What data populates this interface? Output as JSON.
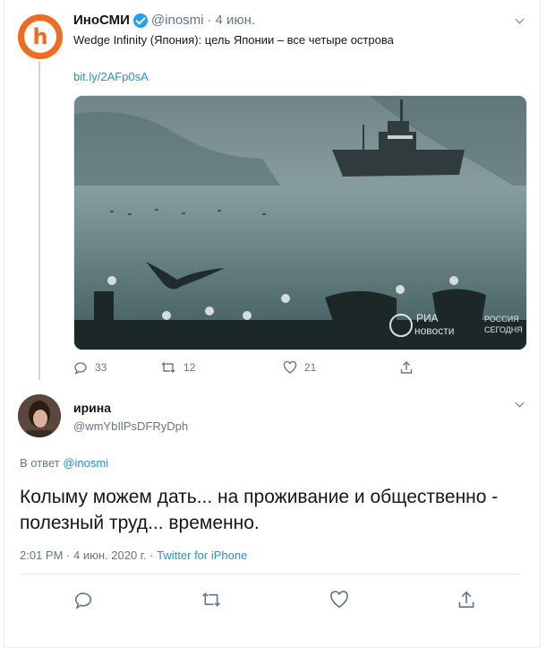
{
  "tweet1": {
    "avatar_letter": "h",
    "name": "ИноСМИ",
    "handle": "@inosmi",
    "separator": "·",
    "date": "4 июн.",
    "text": "Wedge Infinity (Япония): цель Японии – все четыре острова",
    "link": "bit.ly/2AFp0sA",
    "photo_watermark": {
      "line1": "РИА",
      "line2": "новости",
      "line3": "РОССИЯ",
      "line4": "СЕГОДНЯ"
    },
    "actions": {
      "replies": "33",
      "retweets": "12",
      "likes": "21"
    }
  },
  "tweet2": {
    "name": "ирина",
    "handle": "@wmYbIlPsDFRyDph",
    "reply_to_prefix": "В ответ",
    "reply_to_handle": "@inosmi",
    "text": "Колыму можем дать... на проживание и общественно - полезный труд... временно.",
    "time": "2:01 PM",
    "dot": "·",
    "date": "4 июн. 2020 г.",
    "dot2": "·",
    "source": "Twitter for iPhone"
  },
  "colors": {
    "brand_orange": "#f26a1b",
    "link_blue": "#1b95e0",
    "muted": "#657786",
    "verified": "#1da1f2"
  },
  "icons": [
    "reply-icon",
    "retweet-icon",
    "like-icon",
    "share-icon",
    "verified-icon",
    "chevron-down-icon"
  ]
}
